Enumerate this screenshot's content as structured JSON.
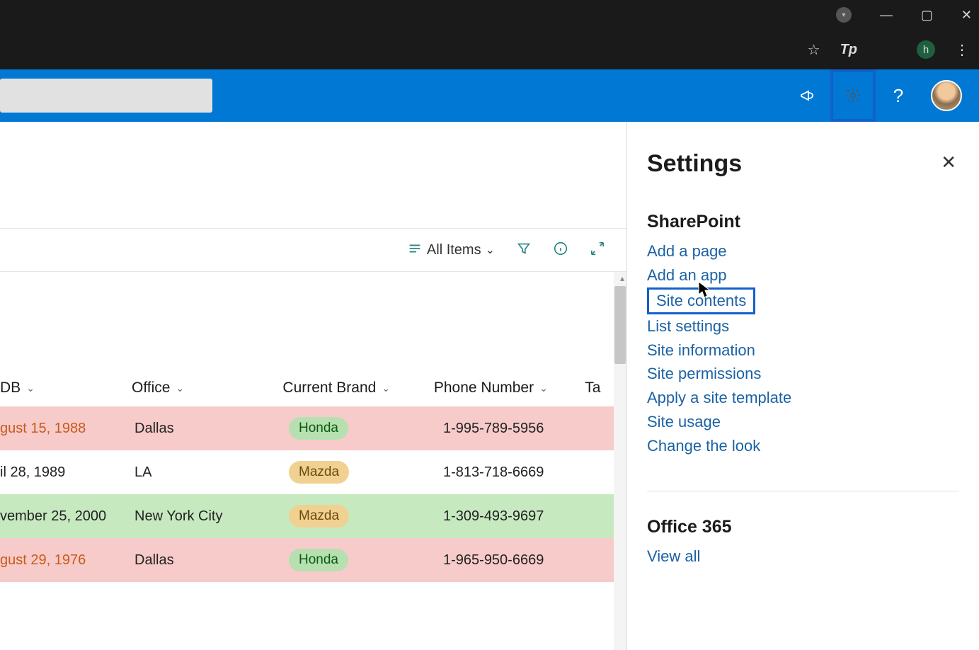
{
  "chrome": {
    "profile_letter": "h"
  },
  "suite": {
    "icons": {
      "megaphone": "megaphone-icon",
      "gear": "gear-icon",
      "help": "?"
    }
  },
  "toolbar": {
    "view_label": "All Items"
  },
  "columns": {
    "dob": "DB",
    "office": "Office",
    "brand": "Current Brand",
    "phone": "Phone Number",
    "ta": "Ta"
  },
  "rows": [
    {
      "dob": "gust 15, 1988",
      "office": "Dallas",
      "brand": "Honda",
      "brand_color": "green",
      "phone": "1-995-789-5956",
      "bg": "pink",
      "orange": true
    },
    {
      "dob": "il 28, 1989",
      "office": "LA",
      "brand": "Mazda",
      "brand_color": "yellow",
      "phone": "1-813-718-6669",
      "bg": "white",
      "orange": false
    },
    {
      "dob": "vember 25, 2000",
      "office": "New York City",
      "brand": "Mazda",
      "brand_color": "yellow",
      "phone": "1-309-493-9697",
      "bg": "green",
      "orange": false
    },
    {
      "dob": "gust 29, 1976",
      "office": "Dallas",
      "brand": "Honda",
      "brand_color": "green",
      "phone": "1-965-950-6669",
      "bg": "pink",
      "orange": true
    }
  ],
  "panel": {
    "title": "Settings",
    "section1": "SharePoint",
    "links": [
      "Add a page",
      "Add an app",
      "Site contents",
      "List settings",
      "Site information",
      "Site permissions",
      "Apply a site template",
      "Site usage",
      "Change the look"
    ],
    "highlighted_index": 2,
    "section2": "Office 365",
    "view_all": "View all"
  }
}
